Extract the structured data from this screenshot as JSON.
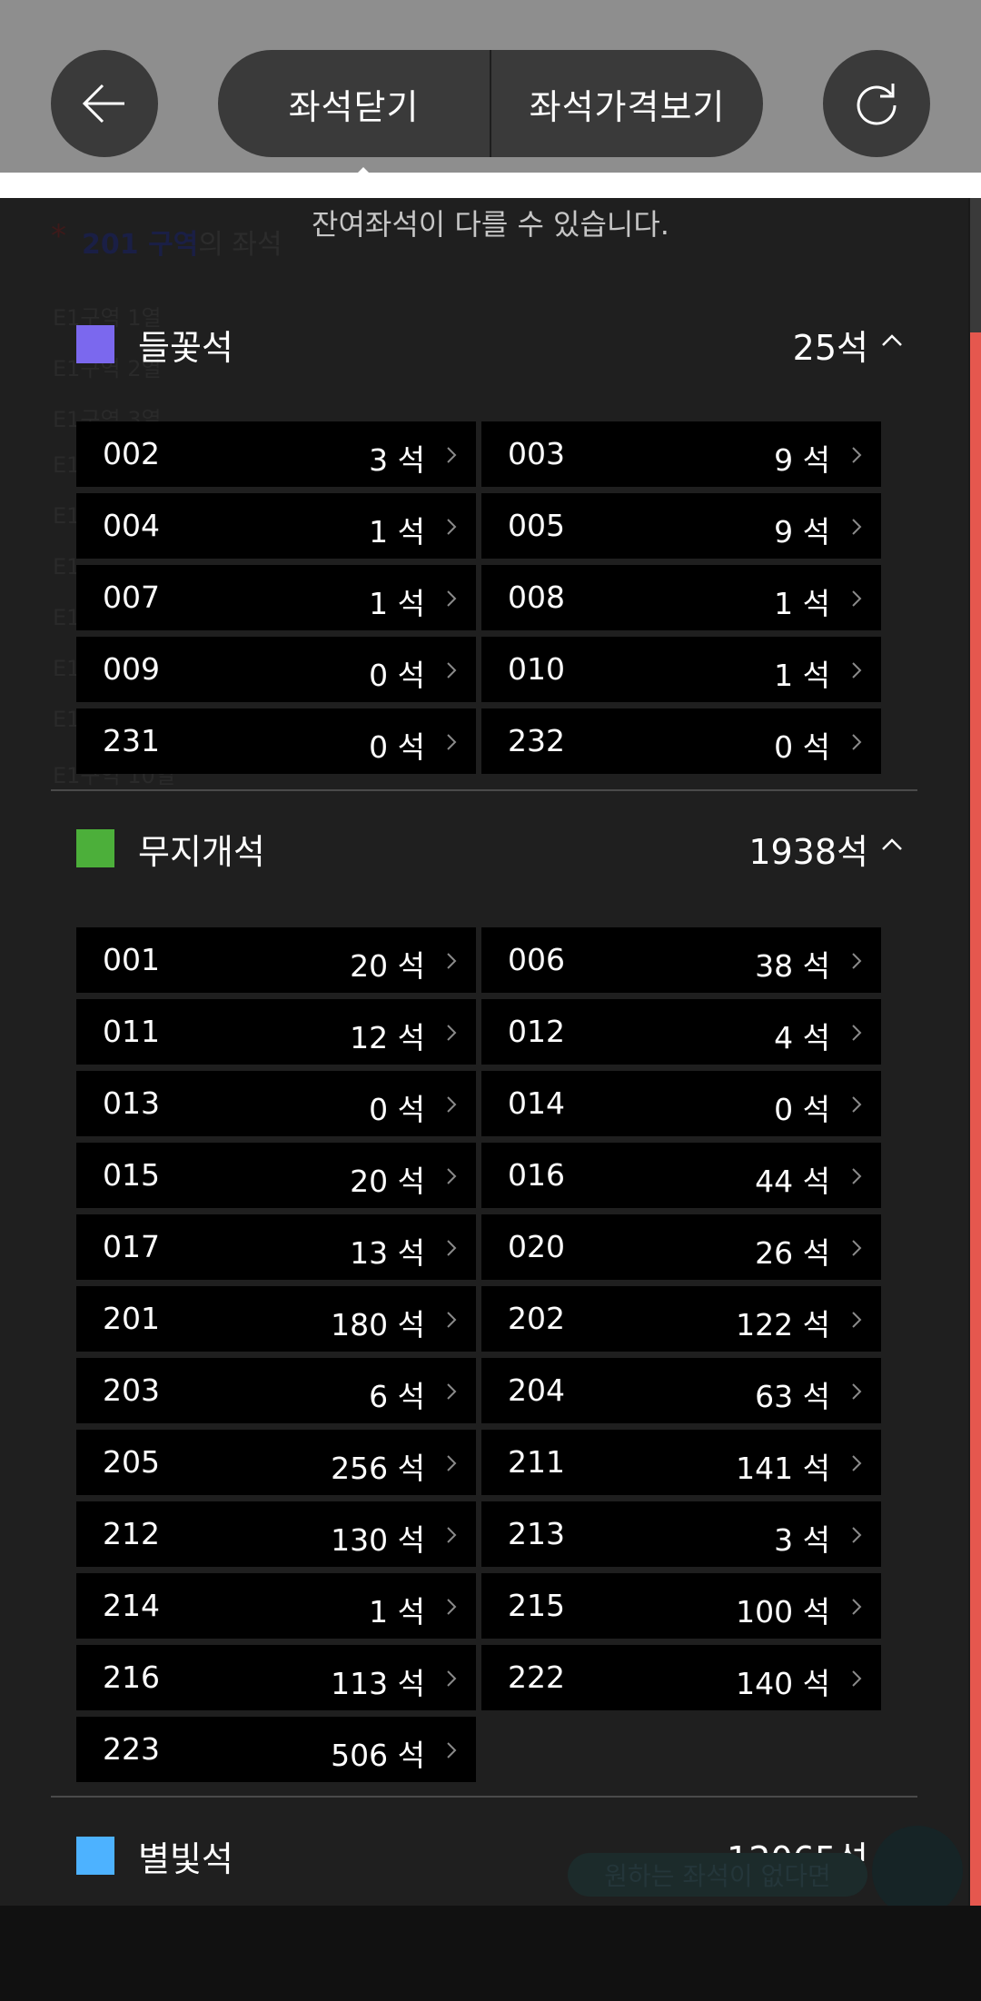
{
  "topbar": {
    "back_icon": "arrow-left-icon",
    "refresh_icon": "refresh-icon",
    "close_seats_label": "좌석닫기",
    "price_label": "좌석가격보기"
  },
  "notice": {
    "line2": "잔여좌석이 다를 수 있습니다.",
    "ghost_star": "*",
    "ghost_zone": "201 구역",
    "ghost_zone_rest": "의 좌석"
  },
  "ghost_rows": [
    "E1구역 1열",
    "E1구역 2열",
    "E1구역 3열",
    "E1",
    "E1",
    "E1",
    "E1",
    "E1",
    "E1",
    "E1구역 10열"
  ],
  "sections": [
    {
      "name": "들꽃석",
      "count": "25석",
      "color": "#7b68ee",
      "expanded": true,
      "blocks": [
        {
          "code": "002",
          "count": "3 석"
        },
        {
          "code": "003",
          "count": "9 석"
        },
        {
          "code": "004",
          "count": "1 석"
        },
        {
          "code": "005",
          "count": "9 석"
        },
        {
          "code": "007",
          "count": "1 석"
        },
        {
          "code": "008",
          "count": "1 석"
        },
        {
          "code": "009",
          "count": "0 석"
        },
        {
          "code": "010",
          "count": "1 석"
        },
        {
          "code": "231",
          "count": "0 석"
        },
        {
          "code": "232",
          "count": "0 석"
        }
      ]
    },
    {
      "name": "무지개석",
      "count": "1938석",
      "color": "#4caf3a",
      "expanded": true,
      "blocks": [
        {
          "code": "001",
          "count": "20 석"
        },
        {
          "code": "006",
          "count": "38 석"
        },
        {
          "code": "011",
          "count": "12 석"
        },
        {
          "code": "012",
          "count": "4 석"
        },
        {
          "code": "013",
          "count": "0 석"
        },
        {
          "code": "014",
          "count": "0 석"
        },
        {
          "code": "015",
          "count": "20 석"
        },
        {
          "code": "016",
          "count": "44 석"
        },
        {
          "code": "017",
          "count": "13 석"
        },
        {
          "code": "020",
          "count": "26 석"
        },
        {
          "code": "201",
          "count": "180 석"
        },
        {
          "code": "202",
          "count": "122 석"
        },
        {
          "code": "203",
          "count": "6 석"
        },
        {
          "code": "204",
          "count": "63 석"
        },
        {
          "code": "205",
          "count": "256 석"
        },
        {
          "code": "211",
          "count": "141 석"
        },
        {
          "code": "212",
          "count": "130 석"
        },
        {
          "code": "213",
          "count": "3 석"
        },
        {
          "code": "214",
          "count": "1 석"
        },
        {
          "code": "215",
          "count": "100 석"
        },
        {
          "code": "216",
          "count": "113 석"
        },
        {
          "code": "222",
          "count": "140 석"
        },
        {
          "code": "223",
          "count": "506 석"
        }
      ]
    },
    {
      "name": "별빛석",
      "count": "12065석",
      "color": "#4db2ff",
      "expanded": false,
      "blocks": []
    }
  ],
  "floating": {
    "ghost_pill": "원하는 좌석이 없다면"
  }
}
